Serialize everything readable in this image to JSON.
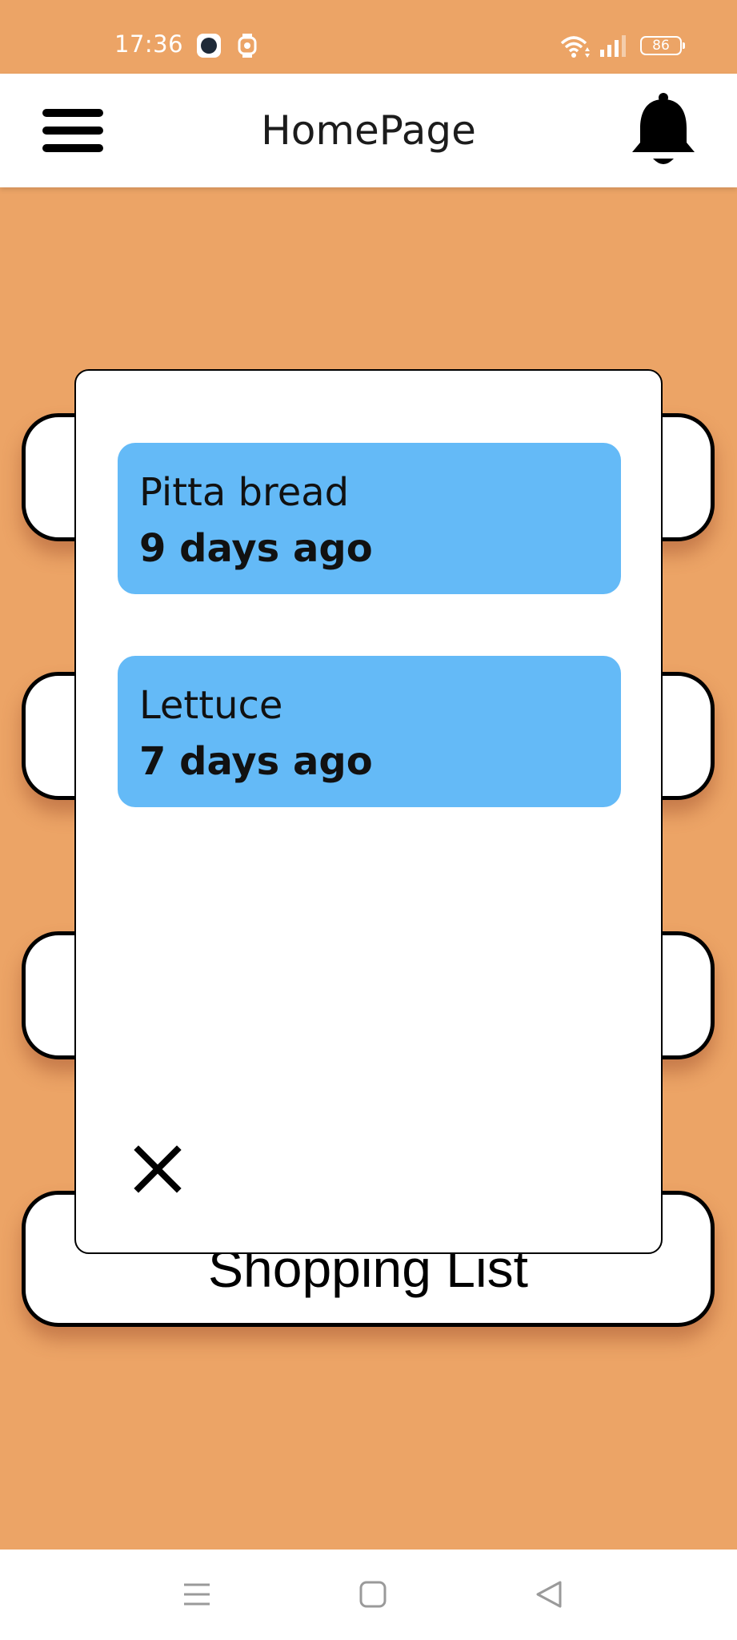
{
  "status_bar": {
    "time": "17:36",
    "battery": "86",
    "icons": [
      "app-notification-icon",
      "watch-icon",
      "wifi-icon",
      "signal-icon",
      "battery-icon"
    ]
  },
  "header": {
    "title": "HomePage",
    "menu_icon": "hamburger-menu-icon",
    "notification_icon": "bell-icon"
  },
  "background": {
    "cards": [
      {
        "label": ""
      },
      {
        "label": ""
      },
      {
        "label": ""
      },
      {
        "label": "Shopping List"
      }
    ]
  },
  "modal": {
    "items": [
      {
        "name": "Pitta bread",
        "age": "9 days ago"
      },
      {
        "name": "Lettuce",
        "age": "7 days ago"
      }
    ],
    "close_icon": "close-icon"
  },
  "nav_bar": {
    "icons": [
      "recent-apps-icon",
      "home-icon",
      "back-icon"
    ]
  },
  "colors": {
    "background": "#eca466",
    "item_card": "#64baf7",
    "header": "#ffffff"
  }
}
